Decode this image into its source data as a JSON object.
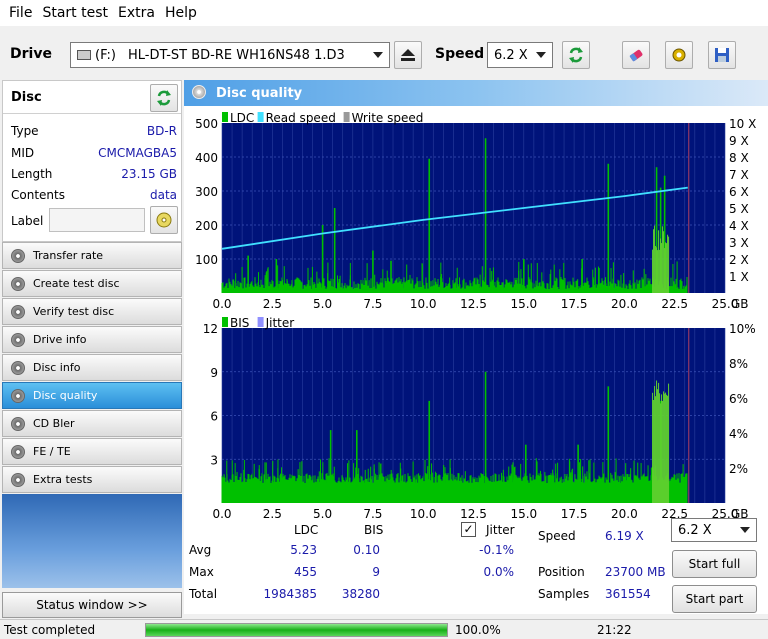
{
  "menu": [
    "File",
    "Start test",
    "Extra",
    "Help"
  ],
  "toolbar": {
    "drive_label": "Drive",
    "drive_letter": "(F:)",
    "drive_value": "HL-DT-ST BD-RE  WH16NS48 1.D3",
    "speed_label": "Speed",
    "speed_value": "6.2 X"
  },
  "disc": {
    "title": "Disc",
    "rows": [
      {
        "key": "Type",
        "value": "BD-R"
      },
      {
        "key": "MID",
        "value": "CMCMAGBA5"
      },
      {
        "key": "Length",
        "value": "23.15 GB"
      },
      {
        "key": "Contents",
        "value": "data"
      }
    ],
    "label_key": "Label"
  },
  "nav": [
    {
      "label": "Transfer rate",
      "active": false
    },
    {
      "label": "Create test disc",
      "active": false
    },
    {
      "label": "Verify test disc",
      "active": false
    },
    {
      "label": "Drive info",
      "active": false
    },
    {
      "label": "Disc info",
      "active": false
    },
    {
      "label": "Disc quality",
      "active": true
    },
    {
      "label": "CD Bler",
      "active": false
    },
    {
      "label": "FE / TE",
      "active": false
    },
    {
      "label": "Extra tests",
      "active": false
    }
  ],
  "status_window_label": "Status window >>",
  "main_title": "Disc quality",
  "chart_data": [
    {
      "type": "bar",
      "legend": [
        "LDC",
        "Read speed",
        "Write speed"
      ],
      "x_ticks": [
        "0.0",
        "2.5",
        "5.0",
        "7.5",
        "10.0",
        "12.5",
        "15.0",
        "17.5",
        "20.0",
        "22.5",
        "25.0"
      ],
      "x_unit": "GB",
      "y_left_ticks": [
        "100",
        "200",
        "300",
        "400",
        "500"
      ],
      "y_right_ticks": [
        "1 X",
        "2 X",
        "3 X",
        "4 X",
        "5 X",
        "6 X",
        "7 X",
        "8 X",
        "9 X",
        "10 X"
      ],
      "xlim": [
        0,
        25
      ],
      "ylim": [
        0,
        500
      ],
      "data_end": 23.15,
      "read_speed": {
        "x": [
          0,
          5,
          10,
          15,
          20,
          23.15
        ],
        "y": [
          2.6,
          3.5,
          4.3,
          5.0,
          5.7,
          6.2
        ]
      },
      "ldc_spikes": [
        {
          "x": 1.3,
          "y": 110
        },
        {
          "x": 2.7,
          "y": 100
        },
        {
          "x": 5.0,
          "y": 200
        },
        {
          "x": 5.6,
          "y": 250
        },
        {
          "x": 7.5,
          "y": 125
        },
        {
          "x": 8.4,
          "y": 95
        },
        {
          "x": 10.3,
          "y": 395
        },
        {
          "x": 13.1,
          "y": 455
        },
        {
          "x": 15.0,
          "y": 100
        },
        {
          "x": 17.9,
          "y": 100
        },
        {
          "x": 19.2,
          "y": 380
        },
        {
          "x": 21.6,
          "y": 370
        },
        {
          "x": 21.8,
          "y": 310
        },
        {
          "x": 22.0,
          "y": 345
        }
      ]
    },
    {
      "type": "bar",
      "legend": [
        "BIS",
        "Jitter"
      ],
      "x_ticks": [
        "0.0",
        "2.5",
        "5.0",
        "7.5",
        "10.0",
        "12.5",
        "15.0",
        "17.5",
        "20.0",
        "22.5",
        "25.0"
      ],
      "x_unit": "GB",
      "y_left_ticks": [
        "3",
        "6",
        "9",
        "12"
      ],
      "y_right_ticks": [
        "2%",
        "4%",
        "6%",
        "8%",
        "10%"
      ],
      "xlim": [
        0,
        25
      ],
      "ylim": [
        0,
        12
      ],
      "data_end": 23.15,
      "bis_spikes": [
        {
          "x": 5.4,
          "y": 5
        },
        {
          "x": 6.7,
          "y": 5
        },
        {
          "x": 10.3,
          "y": 7
        },
        {
          "x": 13.1,
          "y": 9
        },
        {
          "x": 15.1,
          "y": 4
        },
        {
          "x": 17.7,
          "y": 4
        },
        {
          "x": 19.2,
          "y": 8
        },
        {
          "x": 21.8,
          "y": 7
        }
      ]
    }
  ],
  "stats": {
    "col_ldc": "LDC",
    "col_bis": "BIS",
    "col_jitter": "Jitter",
    "rows": [
      {
        "label": "Avg",
        "ldc": "5.23",
        "bis": "0.10",
        "jitter": "-0.1%"
      },
      {
        "label": "Max",
        "ldc": "455",
        "bis": "9",
        "jitter": "0.0%"
      },
      {
        "label": "Total",
        "ldc": "1984385",
        "bis": "38280",
        "jitter": ""
      }
    ],
    "speed_label": "Speed",
    "speed_value": "6.19 X",
    "position_label": "Position",
    "position_value": "23700 MB",
    "samples_label": "Samples",
    "samples_value": "361554",
    "speed_select": "6.2 X",
    "start_full": "Start full",
    "start_part": "Start part"
  },
  "statusbar": {
    "text": "Test completed",
    "progress": 1.0,
    "percent": "100.0%",
    "time": "21:22"
  },
  "colors": {
    "plot_bg": "#00137a",
    "ldc": "#00c000",
    "read": "#40e0ff",
    "accent": "#2a8ed9"
  }
}
